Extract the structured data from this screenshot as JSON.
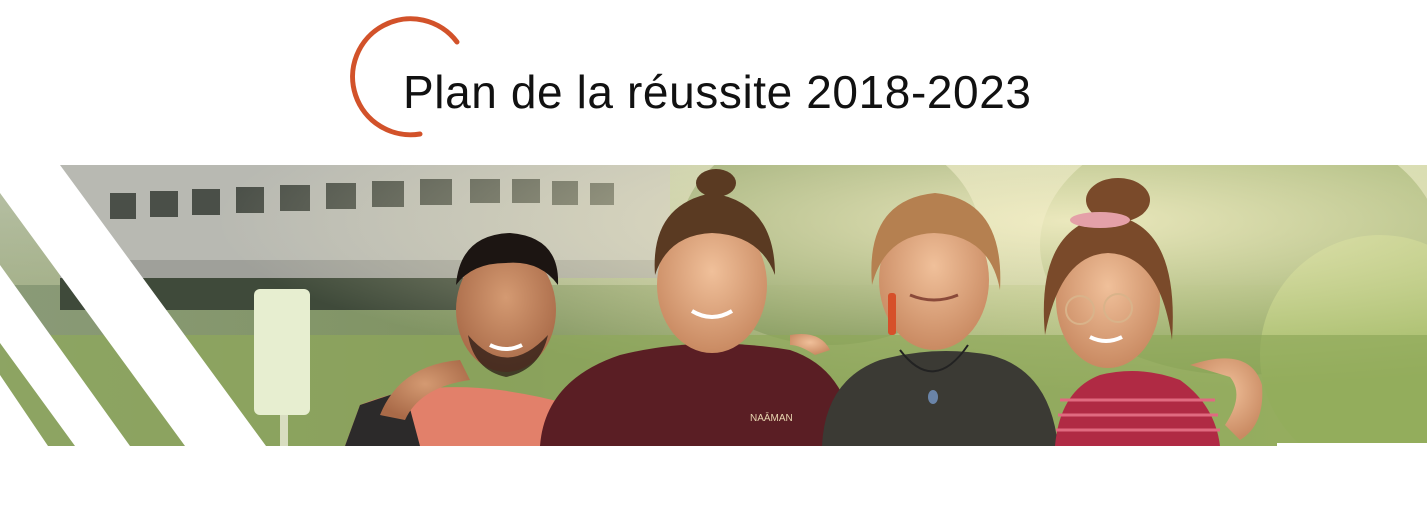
{
  "header": {
    "title": "Plan de la réussite 2018-2023",
    "accent_color": "#d2522a"
  },
  "banner": {
    "image_icon": "students-group-photo",
    "shirt_logo_text": "NAĀMAN",
    "stripe_color": "#ffffff"
  }
}
